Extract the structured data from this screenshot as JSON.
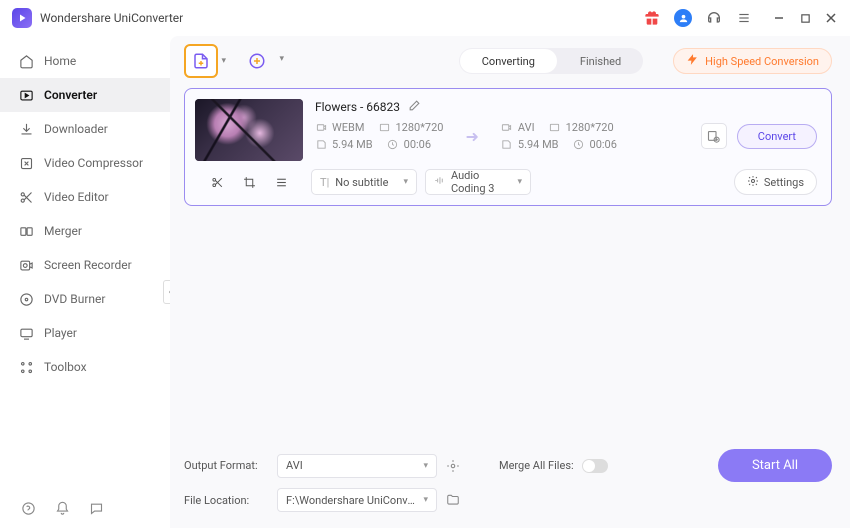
{
  "app_title": "Wondershare UniConverter",
  "sidebar": {
    "items": [
      {
        "label": "Home"
      },
      {
        "label": "Converter"
      },
      {
        "label": "Downloader"
      },
      {
        "label": "Video Compressor"
      },
      {
        "label": "Video Editor"
      },
      {
        "label": "Merger"
      },
      {
        "label": "Screen Recorder"
      },
      {
        "label": "DVD Burner"
      },
      {
        "label": "Player"
      },
      {
        "label": "Toolbox"
      }
    ]
  },
  "tabs": {
    "converting": "Converting",
    "finished": "Finished"
  },
  "highspeed_label": "High Speed Conversion",
  "file": {
    "name": "Flowers - 66823",
    "src": {
      "format": "WEBM",
      "resolution": "1280*720",
      "size": "5.94 MB",
      "duration": "00:06"
    },
    "dst": {
      "format": "AVI",
      "resolution": "1280*720",
      "size": "5.94 MB",
      "duration": "00:06"
    },
    "subtitle_sel": "No subtitle",
    "audio_sel": "Audio Coding 3",
    "settings_label": "Settings",
    "convert_label": "Convert"
  },
  "footer": {
    "output_format_label": "Output Format:",
    "output_format_value": "AVI",
    "file_location_label": "File Location:",
    "file_location_value": "F:\\Wondershare UniConverter",
    "merge_label": "Merge All Files:",
    "start_all": "Start All"
  }
}
